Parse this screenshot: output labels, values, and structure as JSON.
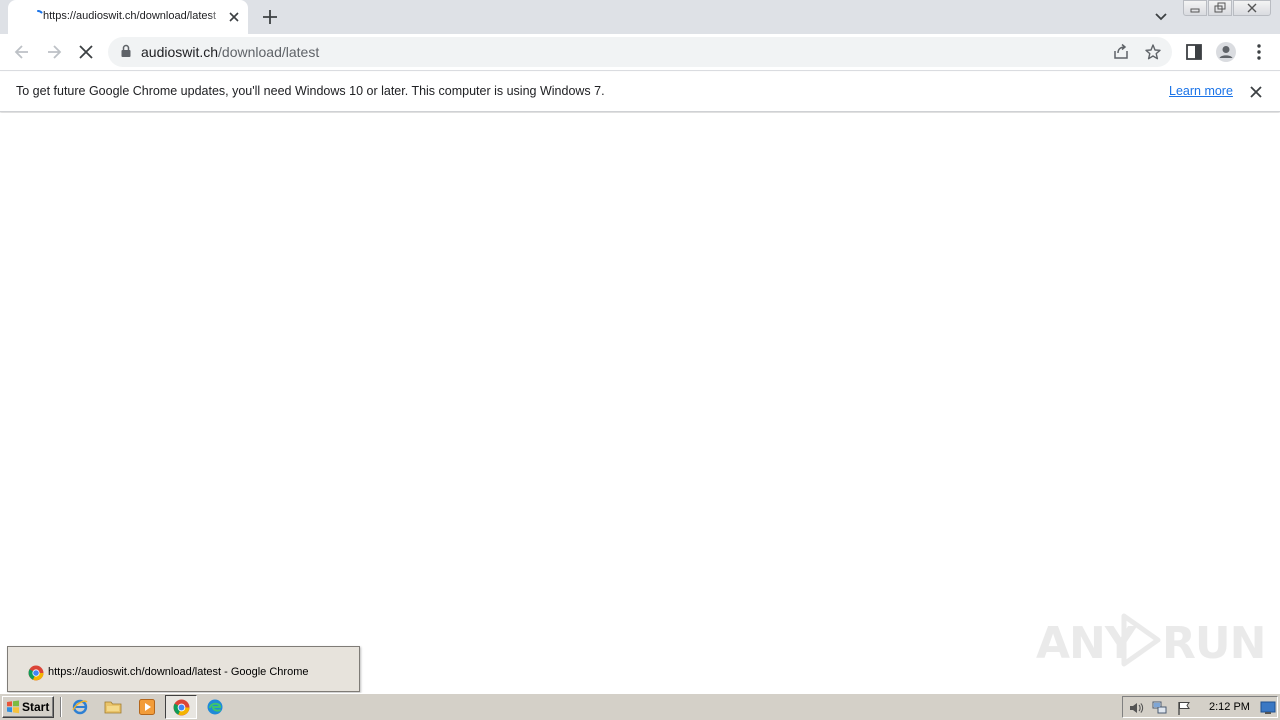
{
  "browser": {
    "tab": {
      "title": "https://audioswit.ch/download/latest",
      "loading": true
    },
    "address_bar": {
      "host": "audioswit.ch",
      "path": "/download/latest",
      "secure": true
    },
    "icons": {
      "back": "arrow-left-icon",
      "forward": "arrow-right-icon",
      "stop": "close-icon",
      "share": "share-icon",
      "bookmark": "star-icon",
      "side_panel": "side-panel-icon",
      "profile": "profile-icon",
      "menu": "kebab-menu-icon"
    }
  },
  "infobar": {
    "message": "To get future Google Chrome updates, you'll need Windows 10 or later. This computer is using Windows 7.",
    "link_label": "Learn more"
  },
  "watermark": {
    "left": "ANY",
    "right": "RUN"
  },
  "taskbar": {
    "start_label": "Start",
    "preview_title": "https://audioswit.ch/download/latest - Google Chrome",
    "clock": "2:12 PM",
    "quick_launch": [
      "internet-explorer-icon",
      "folder-icon",
      "media-player-icon",
      "chrome-icon",
      "edge-icon"
    ]
  },
  "colors": {
    "tabstrip": "#dee1e6",
    "omnibox": "#f1f3f4",
    "link": "#1a73e8",
    "taskbar": "#d4d0c8"
  }
}
